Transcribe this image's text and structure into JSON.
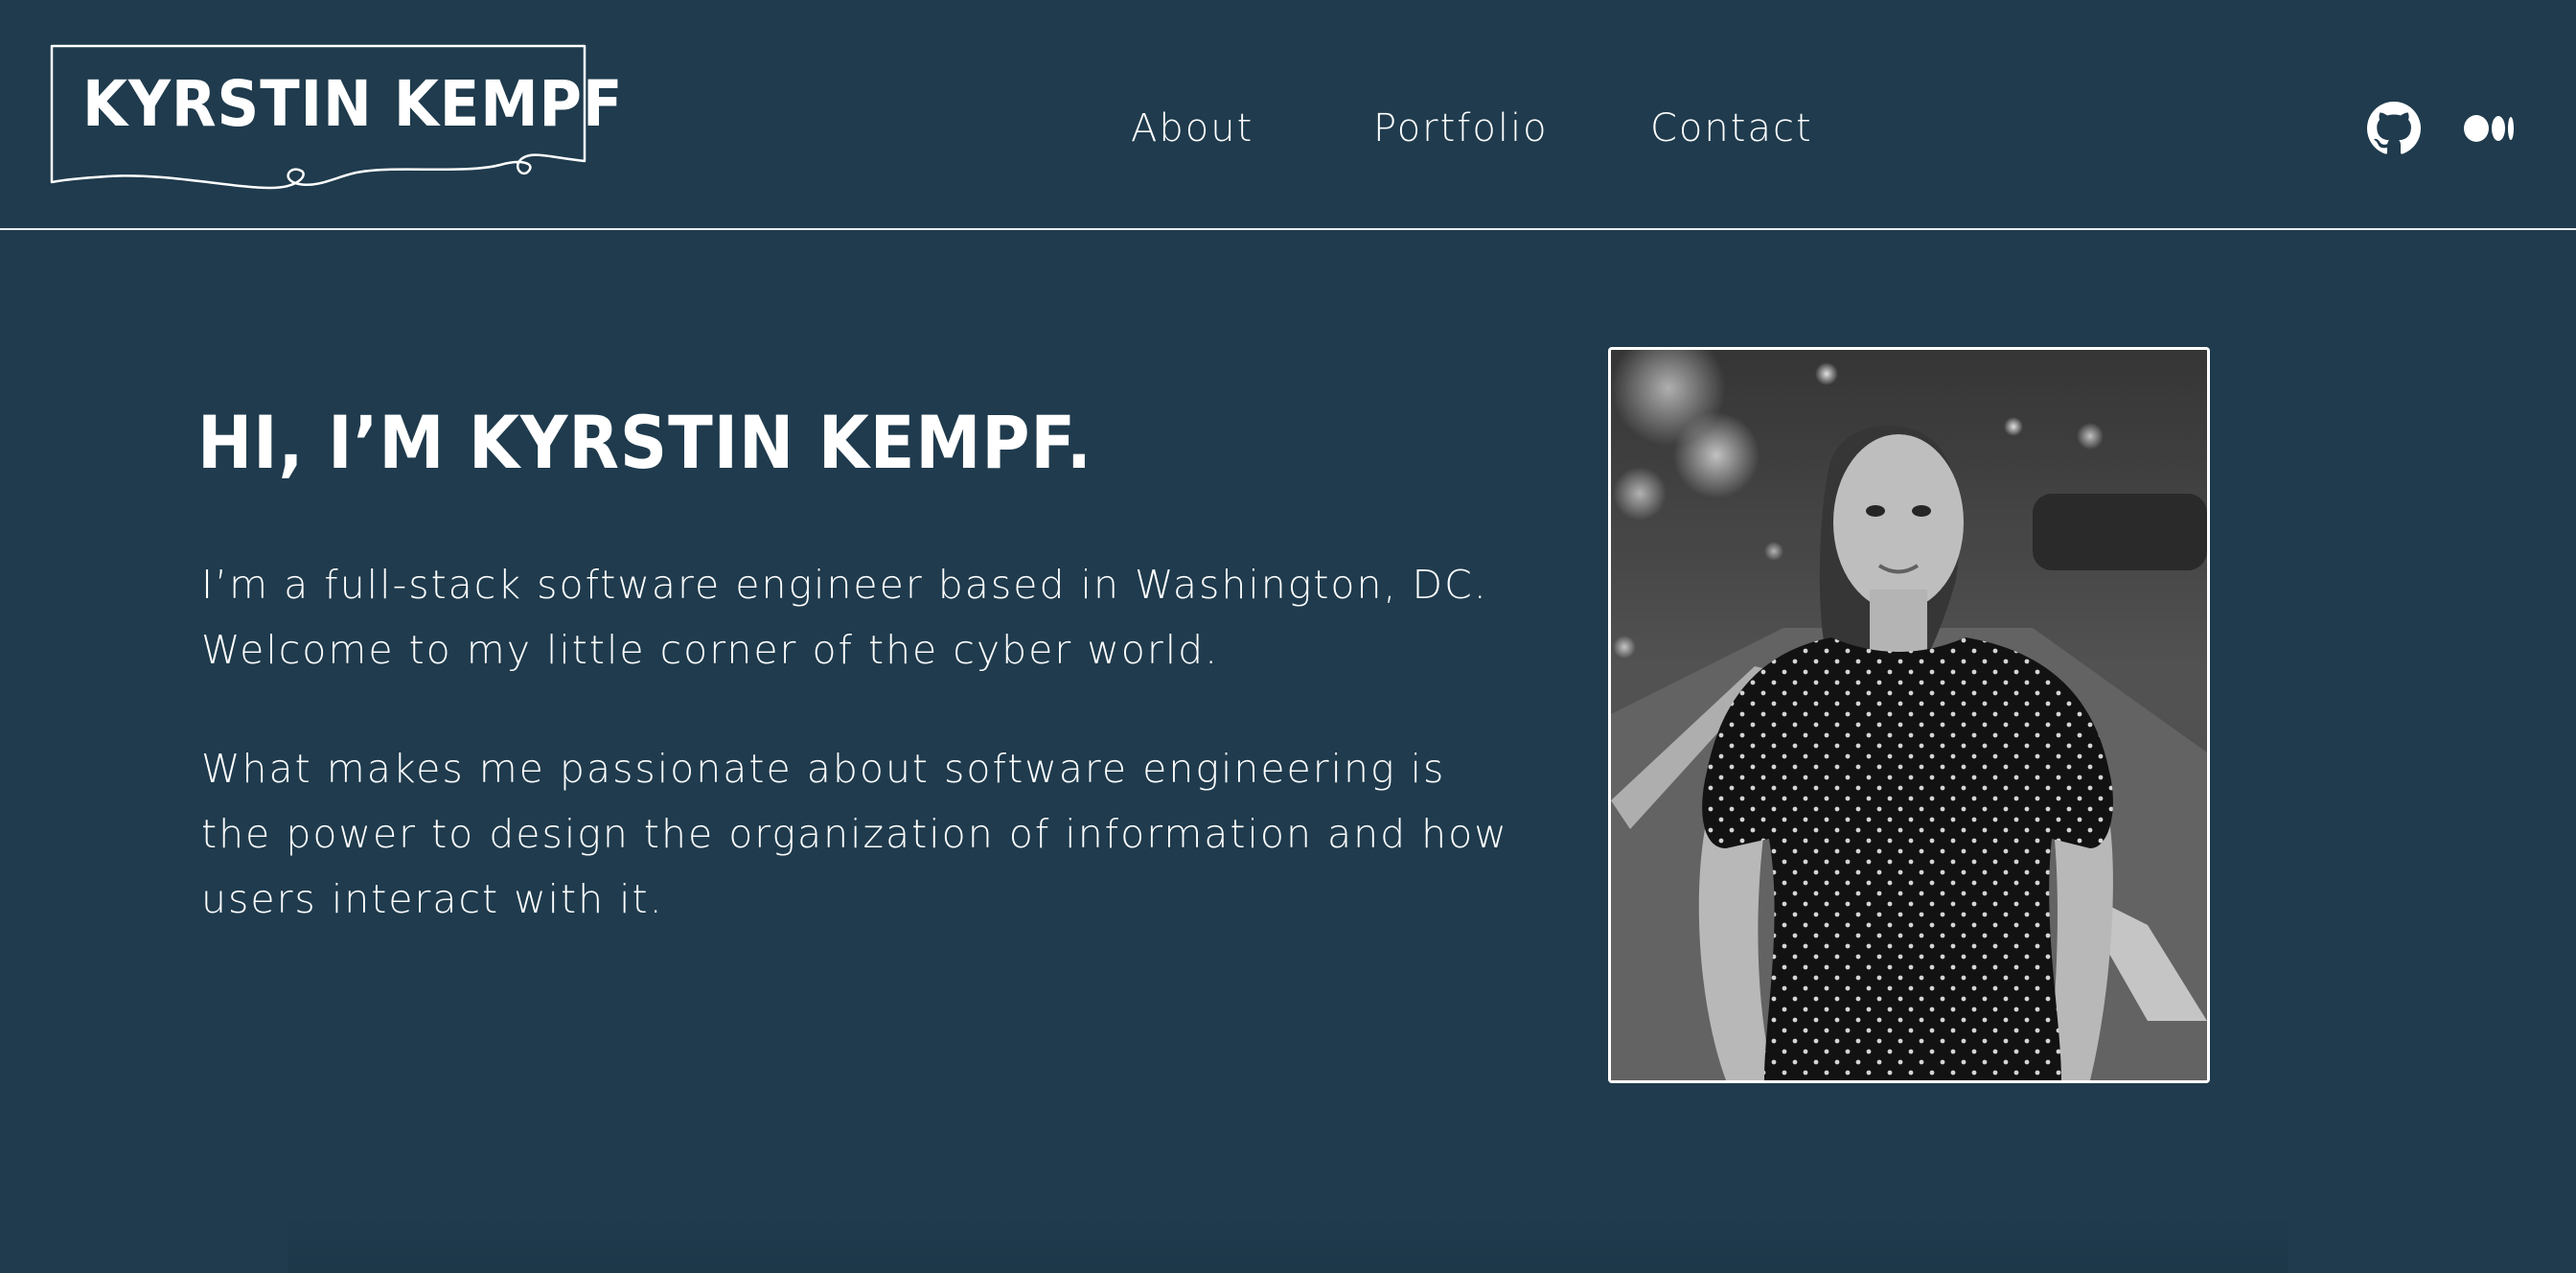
{
  "header": {
    "logo_text": "KYRSTIN KEMPF",
    "nav": [
      {
        "label": "About"
      },
      {
        "label": "Portfolio"
      },
      {
        "label": "Contact"
      }
    ],
    "social": [
      {
        "icon": "github-icon"
      },
      {
        "icon": "medium-icon"
      }
    ]
  },
  "hero": {
    "title": "HI, I’M KYRSTIN KEMPF.",
    "paragraphs": [
      "I’m a full-stack software engineer based in Washington, DC. Welcome to my little corner of the cyber world.",
      "What makes me passionate about software engineering is the power to design the organization of information and how users interact with it."
    ],
    "photo": "portrait photo of Kyrstin Kempf"
  },
  "colors": {
    "background": "#1f3b4d",
    "text": "#ffffff",
    "divider": "#e9eef1"
  }
}
